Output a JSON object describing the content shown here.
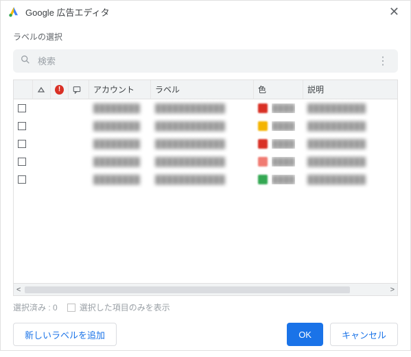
{
  "app": {
    "title": "Google 広告エディタ"
  },
  "dialog": {
    "section_label": "ラベルの選択"
  },
  "search": {
    "placeholder": "検索"
  },
  "columns": {
    "triangle": "",
    "error": "",
    "comment": "",
    "account": "アカウント",
    "label": "ラベル",
    "color": "色",
    "description": "説明"
  },
  "rows": [
    {
      "color": "#d93025"
    },
    {
      "color": "#f4b400"
    },
    {
      "color": "#d93025"
    },
    {
      "color": "#f07b72"
    },
    {
      "color": "#34a853"
    }
  ],
  "status": {
    "selected_prefix": "選択済み :",
    "selected_count": "0",
    "show_only_selected": "選択した項目のみを表示"
  },
  "buttons": {
    "add": "新しいラベルを追加",
    "ok": "OK",
    "cancel": "キャンセル"
  },
  "col_widths": {
    "checkbox": 28,
    "triangle": 26,
    "error": 26,
    "comment": 30,
    "account": 90,
    "label": 150,
    "color": 72
  }
}
